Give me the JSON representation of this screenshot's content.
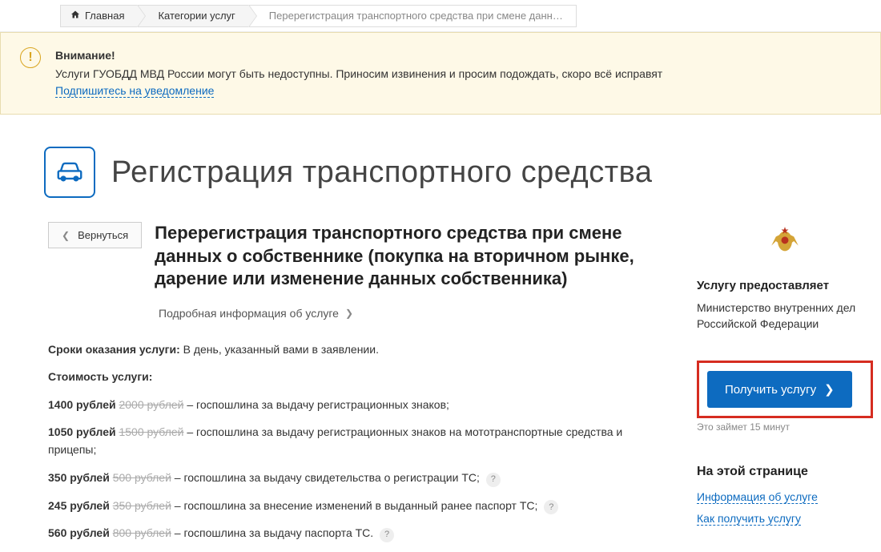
{
  "breadcrumb": {
    "home": "Главная",
    "cat": "Категории услуг",
    "current": "Перерегистрация транспортного средства при смене данн…"
  },
  "alert": {
    "title": "Внимание!",
    "text": "Услуги ГУОБДД МВД России могут быть недоступны. Приносим извинения и просим подождать, скоро всё исправят",
    "link": "Подпишитесь на уведомление"
  },
  "page": {
    "title": "Регистрация транспортного средства",
    "back": "Вернуться",
    "subtitle": "Перерегистрация транспортного средства при смене данных о собственнике (покупка на вторичном рынке, дарение или изменение данных собственника)",
    "details": "Подробная информация об услуге"
  },
  "info": {
    "deadline_label": "Сроки оказания услуги:",
    "deadline_value": "В день, указанный вами в заявлении.",
    "cost_label": "Стоимость услуги:",
    "items": [
      {
        "price": "1400 рублей",
        "old": "2000 рублей",
        "desc": "– госпошлина за выдачу регистрационных знаков;",
        "q": false
      },
      {
        "price": "1050 рублей",
        "old": "1500 рублей",
        "desc": "– госпошлина за выдачу регистрационных знаков на мототранспортные средства и прицепы;",
        "q": false
      },
      {
        "price": "350 рублей",
        "old": "500 рублей",
        "desc": "– госпошлина за выдачу свидетельства о регистрации ТС;",
        "q": true
      },
      {
        "price": "245 рублей",
        "old": "350 рублей",
        "desc": "– госпошлина за внесение изменений в выданный ранее паспорт ТС;",
        "q": true
      },
      {
        "price": "560 рублей",
        "old": "800 рублей",
        "desc": "– госпошлина за выдачу паспорта ТС.",
        "q": true
      }
    ]
  },
  "aside": {
    "provided_by_label": "Услугу предоставляет",
    "provided_by": "Министерство внутренних дел Российской Федерации",
    "cta": "Получить услугу",
    "time": "Это займет 15 минут",
    "on_page": "На этой странице",
    "links": [
      "Информация об услуге",
      "Как получить услугу"
    ]
  }
}
